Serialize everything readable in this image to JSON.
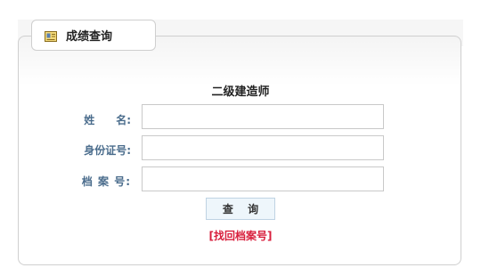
{
  "panel": {
    "tab_title": "成绩查询",
    "tab_icon": "certificate-icon"
  },
  "form": {
    "title": "二级建造师",
    "fields": [
      {
        "label": "姓　　名:",
        "value": "",
        "placeholder": ""
      },
      {
        "label": "身份证号:",
        "value": "",
        "placeholder": ""
      },
      {
        "label": "档 案 号:",
        "value": "",
        "placeholder": ""
      }
    ],
    "submit_label": "查 询",
    "forgot_link": "[找回档案号]"
  },
  "colors": {
    "label": "#4a6c8c",
    "link": "#d81e3c",
    "button_bg": "#eef6fb",
    "border": "#cfcfcf"
  }
}
